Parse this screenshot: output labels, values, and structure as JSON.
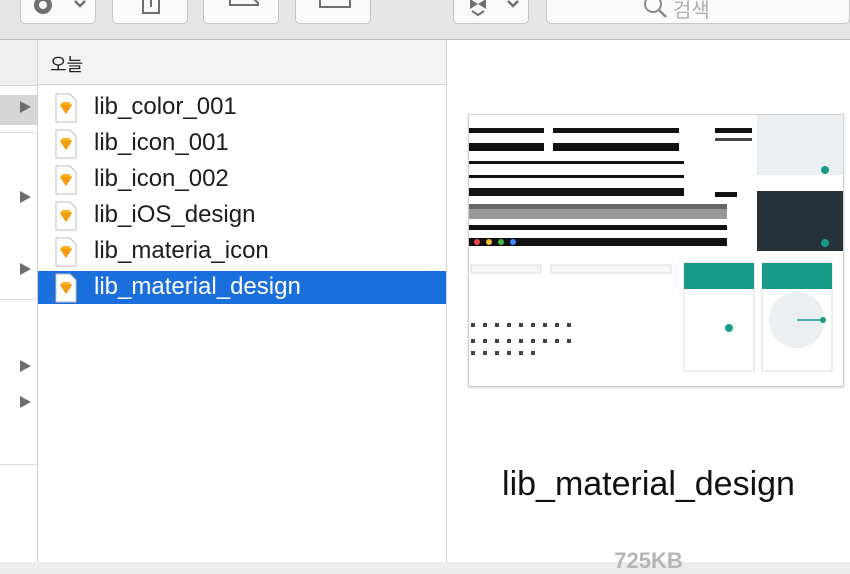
{
  "toolbar": {
    "search_placeholder": "검색"
  },
  "column": {
    "header": "오늘",
    "files": [
      {
        "name": "lib_color_001",
        "selected": false
      },
      {
        "name": "lib_icon_001",
        "selected": false
      },
      {
        "name": "lib_icon_002",
        "selected": false
      },
      {
        "name": "lib_iOS_design",
        "selected": false
      },
      {
        "name": "lib_materia_icon",
        "selected": false
      },
      {
        "name": "lib_material_design",
        "selected": true
      }
    ]
  },
  "preview": {
    "name": "lib_material_design",
    "size": "725KB"
  },
  "colors": {
    "selection": "#1a6fdd",
    "sketch_icon": "#f7b21b",
    "material_teal": "#1a9b8a"
  }
}
